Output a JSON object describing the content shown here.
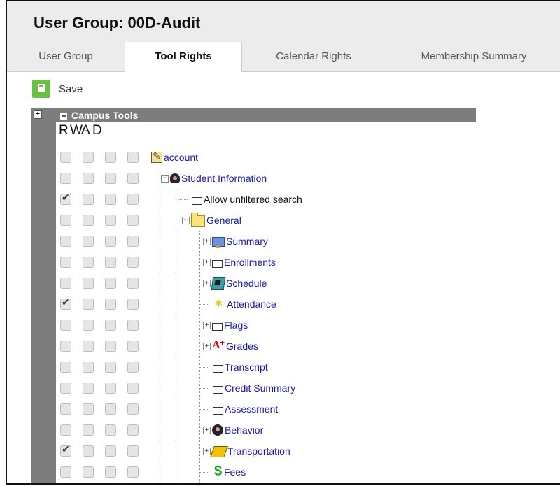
{
  "header": {
    "title": "User Group: 00D-Audit"
  },
  "tabs": [
    {
      "label": "User Group"
    },
    {
      "label": "Tool Rights"
    },
    {
      "label": "Calendar Rights"
    },
    {
      "label": "Membership Summary"
    }
  ],
  "active_tab": "Tool Rights",
  "toolbar": {
    "save_label": "Save"
  },
  "colors": {
    "save_green": "#6abf44",
    "link_blue": "#1a1aa8",
    "header_gray": "#7d7d7d"
  },
  "tree": {
    "section_title": "Campus Tools",
    "columns": [
      "R",
      "W",
      "A",
      "D"
    ],
    "rows": [
      {
        "label": "account",
        "icon": "account-icon",
        "expander": "",
        "level": 0,
        "checks": [
          false,
          false,
          false,
          false
        ],
        "link": true
      },
      {
        "label": "Student Information",
        "icon": "student-icon",
        "expander": "−",
        "level": 1,
        "checks": [
          false,
          false,
          false,
          false
        ],
        "link": true
      },
      {
        "label": "Allow unfiltered search",
        "icon": "page-icon",
        "expander": "",
        "level": 2,
        "checks": [
          true,
          false,
          false,
          false
        ],
        "link": false
      },
      {
        "label": "General",
        "icon": "folder-icon",
        "expander": "−",
        "level": 2,
        "checks": [
          false,
          false,
          false,
          false
        ],
        "link": true
      },
      {
        "label": "Summary",
        "icon": "summary-icon",
        "expander": "+",
        "level": 3,
        "checks": [
          false,
          false,
          false,
          false
        ],
        "link": true
      },
      {
        "label": "Enrollments",
        "icon": "page-icon",
        "expander": "+",
        "level": 3,
        "checks": [
          false,
          false,
          false,
          false
        ],
        "link": true
      },
      {
        "label": "Schedule",
        "icon": "schedule-icon",
        "expander": "+",
        "level": 3,
        "checks": [
          false,
          false,
          false,
          false
        ],
        "link": true
      },
      {
        "label": "Attendance",
        "icon": "attendance-icon",
        "expander": "",
        "level": 3,
        "checks": [
          true,
          false,
          false,
          false
        ],
        "link": true
      },
      {
        "label": "Flags",
        "icon": "page-icon",
        "expander": "+",
        "level": 3,
        "checks": [
          false,
          false,
          false,
          false
        ],
        "link": true
      },
      {
        "label": "Grades",
        "icon": "grades-icon",
        "expander": "+",
        "level": 3,
        "checks": [
          false,
          false,
          false,
          false
        ],
        "link": true
      },
      {
        "label": "Transcript",
        "icon": "page-icon",
        "expander": "",
        "level": 3,
        "checks": [
          false,
          false,
          false,
          false
        ],
        "link": true
      },
      {
        "label": "Credit Summary",
        "icon": "page-icon",
        "expander": "",
        "level": 3,
        "checks": [
          false,
          false,
          false,
          false
        ],
        "link": true
      },
      {
        "label": "Assessment",
        "icon": "page-icon",
        "expander": "",
        "level": 3,
        "checks": [
          false,
          false,
          false,
          false
        ],
        "link": true
      },
      {
        "label": "Behavior",
        "icon": "behavior-icon",
        "expander": "+",
        "level": 3,
        "checks": [
          false,
          false,
          false,
          false
        ],
        "link": true
      },
      {
        "label": "Transportation",
        "icon": "transport-icon",
        "expander": "+",
        "level": 3,
        "checks": [
          true,
          false,
          false,
          false
        ],
        "link": true
      },
      {
        "label": "Fees",
        "icon": "fees-icon",
        "expander": "",
        "level": 3,
        "checks": [
          false,
          false,
          false,
          false
        ],
        "link": true
      }
    ]
  }
}
